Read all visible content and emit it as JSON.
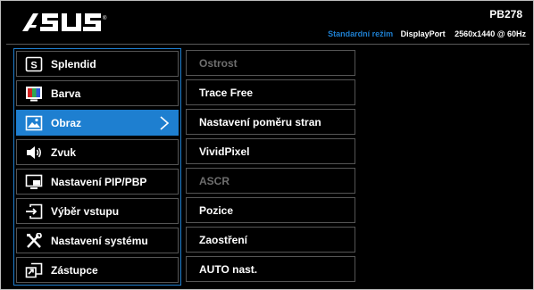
{
  "header": {
    "brand": "ASUS",
    "model": "PB278",
    "mode": "Standardní režim",
    "port": "DisplayPort",
    "resolution": "2560x1440 @ 60Hz"
  },
  "main_menu": {
    "items": [
      {
        "label": "Splendid",
        "icon": "splendid-icon",
        "active": false
      },
      {
        "label": "Barva",
        "icon": "color-icon",
        "active": false
      },
      {
        "label": "Obraz",
        "icon": "image-icon",
        "active": true
      },
      {
        "label": "Zvuk",
        "icon": "speaker-icon",
        "active": false
      },
      {
        "label": "Nastavení PIP/PBP",
        "icon": "pip-icon",
        "active": false
      },
      {
        "label": "Výběr vstupu",
        "icon": "input-icon",
        "active": false
      },
      {
        "label": "Nastavení systému",
        "icon": "tools-icon",
        "active": false
      },
      {
        "label": "Zástupce",
        "icon": "shortcut-icon",
        "active": false
      }
    ]
  },
  "submenu": {
    "items": [
      {
        "label": "Ostrost",
        "enabled": false
      },
      {
        "label": "Trace Free",
        "enabled": true
      },
      {
        "label": "Nastavení poměru stran",
        "enabled": true
      },
      {
        "label": "VividPixel",
        "enabled": true
      },
      {
        "label": "ASCR",
        "enabled": false
      },
      {
        "label": "Pozice",
        "enabled": true
      },
      {
        "label": "Zaostření",
        "enabled": true
      },
      {
        "label": "AUTO nast.",
        "enabled": true
      }
    ]
  },
  "colors": {
    "accent": "#1e7fd0",
    "background": "#000000",
    "text": "#ffffff",
    "disabled_text": "#6e6e6e",
    "border": "#555555"
  }
}
